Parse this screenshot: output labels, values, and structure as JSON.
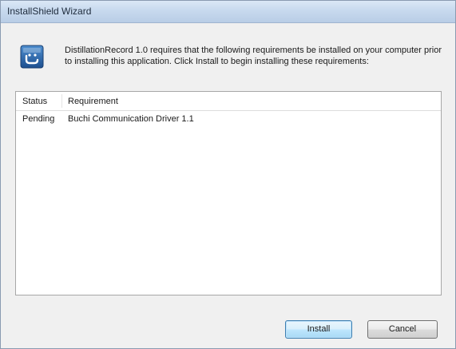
{
  "window": {
    "title": "InstallShield Wizard"
  },
  "message": {
    "text": "DistillationRecord 1.0 requires that the following requirements be installed on your computer prior to installing this application. Click Install to begin installing these requirements:",
    "icon": "installer-icon"
  },
  "requirements_list": {
    "columns": [
      "Status",
      "Requirement"
    ],
    "rows": [
      {
        "status": "Pending",
        "requirement": "Buchi Communication Driver 1.1"
      }
    ]
  },
  "buttons": {
    "install_label": "Install",
    "cancel_label": "Cancel"
  },
  "colors": {
    "dialog_background": "#f0f0f0",
    "titlebar": "#c7d9ee",
    "default_button_border": "#3c7fb1"
  }
}
